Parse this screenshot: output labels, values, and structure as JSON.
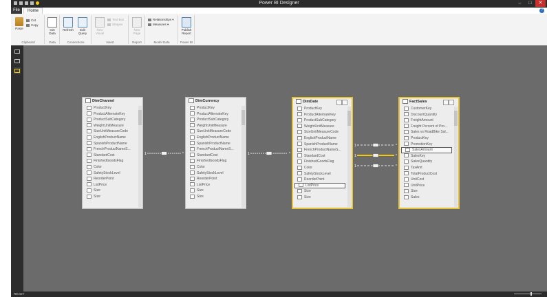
{
  "window": {
    "title": "Power BI Designer"
  },
  "tabs": {
    "file": "File",
    "home": "Home"
  },
  "ribbon": {
    "clipboard": {
      "label": "Clipboard",
      "paste": "Paste",
      "cut": "Cut",
      "copy": "Copy"
    },
    "data": {
      "label": "Data",
      "get_data": "Get Data"
    },
    "connections": {
      "label": "Connections",
      "refresh": "Refresh",
      "edit_query": "Edit Query"
    },
    "insert": {
      "label": "Insert",
      "new_visual": "New Visual",
      "text_box": "Text Box",
      "shapes": "Shapes"
    },
    "report": {
      "label": "Report",
      "new_page": "New Page"
    },
    "model_data": {
      "label": "Model Data",
      "relationships": "Relationships",
      "measures": "Measures"
    },
    "power_bi": {
      "label": "Power BI",
      "publish": "Publish Report"
    }
  },
  "status": {
    "text": "READY"
  },
  "tables": [
    {
      "name": "DimChannel",
      "columns": [
        "ProductKey",
        "ProductAlternateKey",
        "ProductSubCategory",
        "WeightUnitMeasure",
        "SizeUnitMeasureCode",
        "EnglishProductName",
        "SpanishProductName",
        "FrenchProductNameS...",
        "StandardCost",
        "FinishedGoodsFlag",
        "Color",
        "SafetyStockLevel",
        "ReorderPoint",
        "ListPrice",
        "Size",
        "Size"
      ]
    },
    {
      "name": "DimCurrency",
      "columns": [
        "ProductKey",
        "ProductAlternateKey",
        "ProductSubCategory",
        "WeightUnitMeasure",
        "SizeUnitMeasureCode",
        "EnglishProductName",
        "SpanishProductName",
        "FrenchProductNameS...",
        "StandardCost",
        "FinishedGoodsFlag",
        "Color",
        "SafetyStockLevel",
        "ReorderPoint",
        "ListPrice",
        "Size",
        "Size"
      ]
    },
    {
      "name": "DimDate",
      "columns": [
        "ProductKey",
        "ProductAlternateKey",
        "ProductSubCategory",
        "WeightUnitMeasure",
        "SizeUnitMeasureCode",
        "EnglishProductName",
        "SpanishProductName",
        "FrenchProductNameS...",
        "StandardCost",
        "FinishedGoodsFlag",
        "Color",
        "SafetyStockLevel",
        "ReorderPoint",
        "ListPrice",
        "Size",
        "Size"
      ]
    },
    {
      "name": "FactSales",
      "columns": [
        "CustomerKey",
        "DiscountQuantity",
        "FreightAmount",
        "Freight Percent of Pro...",
        "Sales vs RoadBike Sal...",
        "ProductKey",
        "PromotionKey",
        "SalesAmount",
        "SalesKey",
        "SalesQuantity",
        "TaxAmt",
        "TotalProductCost",
        "UnitCost",
        "UnitPrice",
        "Size",
        "Sales"
      ]
    }
  ],
  "relationships": [
    {
      "from": "DimChannel",
      "to": "DimCurrency",
      "from_card": "1",
      "to_card": "*"
    },
    {
      "from": "DimCurrency",
      "to": "DimDate",
      "from_card": "1",
      "to_card": "*"
    },
    {
      "from": "DimDate",
      "to": "FactSales",
      "from_card": "1",
      "to_card": "*"
    },
    {
      "from": "DimDate",
      "to": "FactSales",
      "from_card": "1",
      "to_card": "*"
    },
    {
      "from": "DimDate",
      "to": "FactSales",
      "from_card": "1",
      "to_card": "*"
    }
  ]
}
